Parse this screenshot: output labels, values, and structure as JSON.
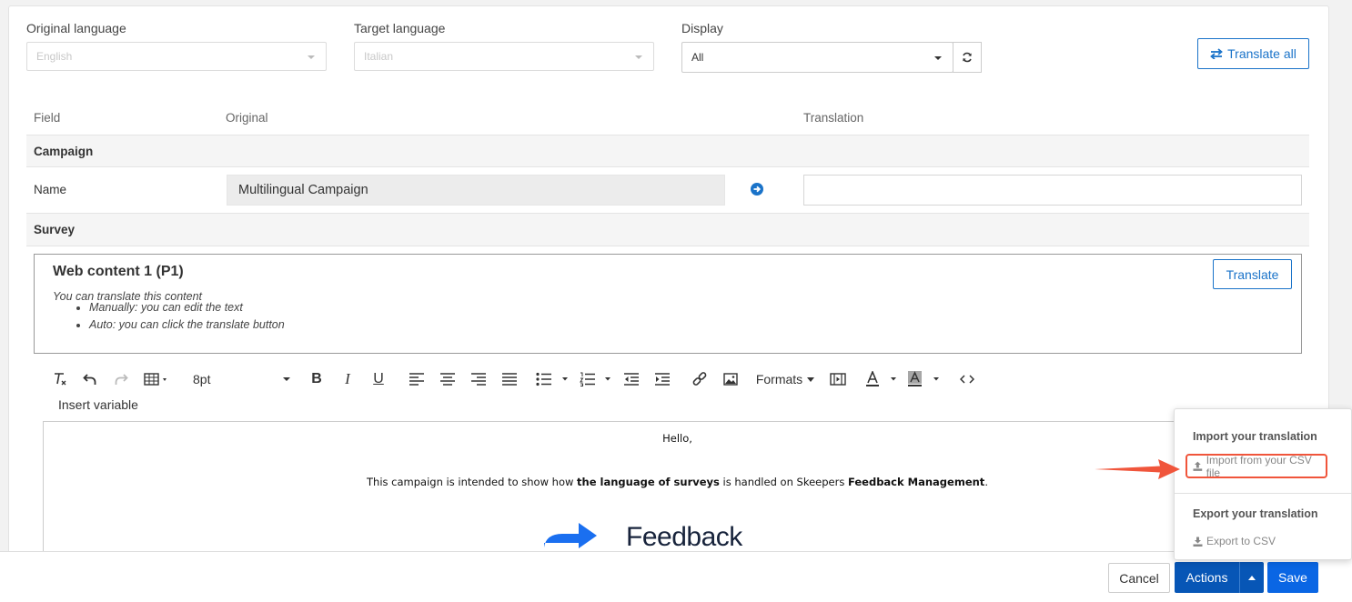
{
  "filters": {
    "original_language": {
      "label": "Original language",
      "value": "English"
    },
    "target_language": {
      "label": "Target language",
      "value": "Italian"
    },
    "display": {
      "label": "Display",
      "value": "All"
    },
    "translate_all_label": "Translate all"
  },
  "table": {
    "headers": {
      "field": "Field",
      "original": "Original",
      "translation": "Translation"
    },
    "sections": {
      "campaign": "Campaign",
      "survey": "Survey"
    },
    "name_row": {
      "field": "Name",
      "original": "Multilingual Campaign",
      "translation": ""
    }
  },
  "web_content": {
    "title": "Web content 1 (P1)",
    "intro": "You can translate this content",
    "bullets": [
      "Manually: you can edit the text",
      "Auto: you can click the translate button"
    ],
    "translate_label": "Translate"
  },
  "toolbar": {
    "font_size": "8pt",
    "formats_label": "Formats",
    "insert_variable": "Insert variable"
  },
  "editor": {
    "greeting": "Hello,",
    "body_pre": "This campaign is intended to show how ",
    "body_bold1": "the language of surveys",
    "body_mid": " is handled on Skeepers ",
    "body_bold2": "Feedback Management",
    "body_end": ".",
    "logo_text": "Feedback"
  },
  "actions_menu": {
    "import_header": "Import your translation",
    "import_item": "Import from your CSV file",
    "export_header": "Export your translation",
    "export_item": "Export to CSV"
  },
  "footer": {
    "cancel": "Cancel",
    "actions": "Actions",
    "save": "Save"
  },
  "colors": {
    "accent": "#1a73c9",
    "primary_button": "#0a66e4",
    "annotation": "#f0553b"
  }
}
